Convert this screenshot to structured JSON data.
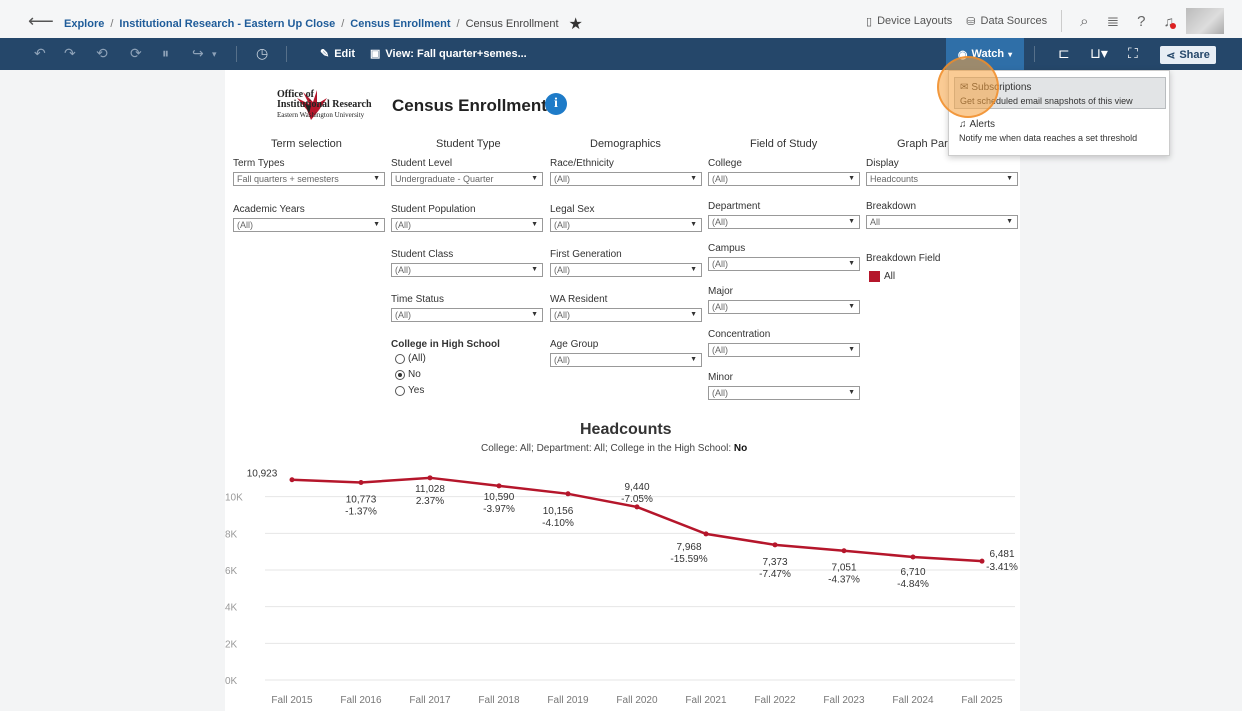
{
  "breadcrumb": {
    "items": [
      "Explore",
      "Institutional Research - Eastern Up Close",
      "Census Enrollment"
    ],
    "current": "Census Enrollment",
    "separator": "/"
  },
  "topbar": {
    "device_layouts": "Device Layouts",
    "data_sources": "Data Sources"
  },
  "toolbar": {
    "edit_label": "Edit",
    "view_label": "View: Fall quarter+semes...",
    "watch_label": "Watch",
    "share_label": "Share"
  },
  "dashboard": {
    "logo_line1": "Office of",
    "logo_line2": "Institutional Research",
    "logo_line3": "Eastern Washington University",
    "title": "Census Enrollment",
    "sections": [
      "Term selection",
      "Student Type",
      "Demographics",
      "Field of Study",
      "Graph Para"
    ]
  },
  "filters": {
    "term_types": {
      "label": "Term Types",
      "value": "Fall quarters + semesters"
    },
    "academic_years": {
      "label": "Academic Years",
      "value": "(All)"
    },
    "student_level": {
      "label": "Student Level",
      "value": "Undergraduate - Quarter"
    },
    "student_population": {
      "label": "Student Population",
      "value": "(All)"
    },
    "student_class": {
      "label": "Student Class",
      "value": "(All)"
    },
    "time_status": {
      "label": "Time Status",
      "value": "(All)"
    },
    "college_hs": {
      "label": "College in High School",
      "options": [
        "(All)",
        "No",
        "Yes"
      ],
      "selected": "No"
    },
    "race": {
      "label": "Race/Ethnicity",
      "value": "(All)"
    },
    "legal_sex": {
      "label": "Legal Sex",
      "value": "(All)"
    },
    "first_gen": {
      "label": "First Generation",
      "value": "(All)"
    },
    "wa_resident": {
      "label": "WA Resident",
      "value": "(All)"
    },
    "age_group": {
      "label": "Age Group",
      "value": "(All)"
    },
    "college": {
      "label": "College",
      "value": "(All)"
    },
    "department": {
      "label": "Department",
      "value": "(All)"
    },
    "campus": {
      "label": "Campus",
      "value": "(All)"
    },
    "major": {
      "label": "Major",
      "value": "(All)"
    },
    "concentration": {
      "label": "Concentration",
      "value": "(All)"
    },
    "minor": {
      "label": "Minor",
      "value": "(All)"
    },
    "display": {
      "label": "Display",
      "value": "Headcounts"
    },
    "breakdown": {
      "label": "Breakdown",
      "value": "All"
    },
    "breakdown_field": {
      "label": "Breakdown Field",
      "legend": "All",
      "color": "#b5162b"
    }
  },
  "chart": {
    "title": "Headcounts",
    "subtitle_prefix": "College: All; Department: All; College in the High School: ",
    "subtitle_bold": "No"
  },
  "chart_data": {
    "type": "line",
    "categories": [
      "Fall 2015",
      "Fall 2016",
      "Fall 2017",
      "Fall 2018",
      "Fall 2019",
      "Fall 2020",
      "Fall 2021",
      "Fall 2022",
      "Fall 2023",
      "Fall 2024",
      "Fall 2025"
    ],
    "values": [
      10923,
      10773,
      11028,
      10590,
      10156,
      9440,
      7968,
      7373,
      7051,
      6710,
      6481
    ],
    "labels": [
      "10,923",
      "10,773",
      "11,028",
      "10,590",
      "10,156",
      "9,440",
      "7,968",
      "7,373",
      "7,051",
      "6,710",
      "6,481"
    ],
    "pct": [
      "",
      "-1.37%",
      "2.37%",
      "-3.97%",
      "-4.10%",
      "-7.05%",
      "-15.59%",
      "-7.47%",
      "-4.37%",
      "-4.84%",
      "-3.41%"
    ],
    "yticks": [
      "0K",
      "2K",
      "4K",
      "6K",
      "8K",
      "10K"
    ],
    "ylim": [
      0,
      12000
    ],
    "color": "#b5162b",
    "grid": true
  },
  "watch_menu": {
    "subscriptions_title": "Subscriptions",
    "subscriptions_desc": "Get scheduled email snapshots of this view",
    "alerts_title": "Alerts",
    "alerts_desc": "Notify me when data reaches a set threshold"
  }
}
